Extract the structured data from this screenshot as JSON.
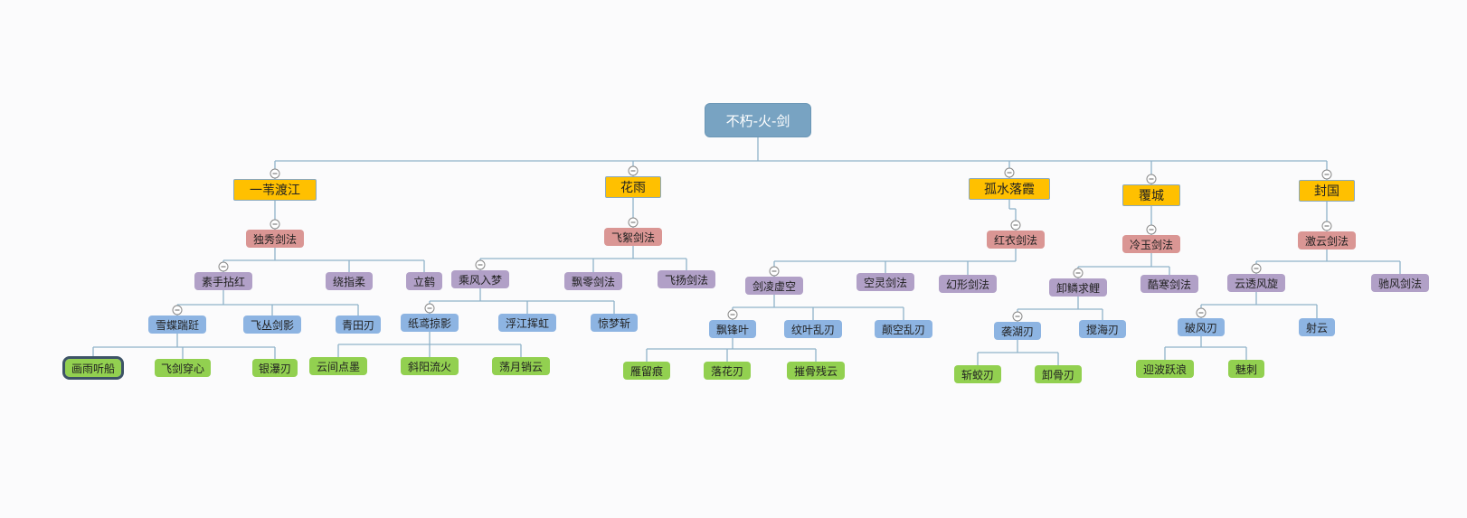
{
  "theme": {
    "root_color": "#78a3c2",
    "level1_color": "#ffc000",
    "level2_color": "#da9694",
    "level3_color": "#b1a0c7",
    "level4_color": "#8db4e2",
    "level5_color": "#92d050",
    "line_color": "#8fb2c9"
  },
  "selected_node": "画雨听船",
  "mindmap": {
    "label": "不朽-火-剑",
    "children": [
      {
        "label": "一苇渡江",
        "collapsible": true,
        "children": [
          {
            "label": "独秀剑法",
            "collapsible": true,
            "children": [
              {
                "label": "素手拈红",
                "collapsible": true,
                "children": [
                  {
                    "label": "雪蝶踹跹",
                    "collapsible": true,
                    "children": [
                      {
                        "label": "画雨听船"
                      },
                      {
                        "label": "飞剑穿心"
                      },
                      {
                        "label": "银瀑刃"
                      }
                    ]
                  },
                  {
                    "label": "飞丛剑影"
                  },
                  {
                    "label": "青田刃"
                  }
                ]
              },
              {
                "label": "绕指柔"
              },
              {
                "label": "立鹤"
              }
            ]
          }
        ]
      },
      {
        "label": "花雨",
        "collapsible": true,
        "children": [
          {
            "label": "飞絮剑法",
            "collapsible": true,
            "children": [
              {
                "label": "乘风入梦",
                "collapsible": true,
                "children": [
                  {
                    "label": "纸鸢掠影",
                    "collapsible": true,
                    "children": [
                      {
                        "label": "云间点墨"
                      },
                      {
                        "label": "斜阳流火"
                      },
                      {
                        "label": "荡月销云"
                      }
                    ]
                  },
                  {
                    "label": "浮江挥虹"
                  },
                  {
                    "label": "惊梦斩"
                  }
                ]
              },
              {
                "label": "飘零剑法"
              },
              {
                "label": "飞扬剑法"
              }
            ]
          }
        ]
      },
      {
        "label": "孤水落霞",
        "collapsible": true,
        "children": [
          {
            "label": "红衣剑法",
            "collapsible": true,
            "children": [
              {
                "label": "剑凌虚空",
                "collapsible": true,
                "children": [
                  {
                    "label": "飘锋叶",
                    "collapsible": true,
                    "children": [
                      {
                        "label": "雁留痕"
                      },
                      {
                        "label": "落花刃"
                      },
                      {
                        "label": "摧骨残云"
                      }
                    ]
                  },
                  {
                    "label": "纹叶乱刃"
                  },
                  {
                    "label": "颠空乱刃"
                  }
                ]
              },
              {
                "label": "空灵剑法"
              },
              {
                "label": "幻形剑法"
              }
            ]
          }
        ]
      },
      {
        "label": "覆城",
        "collapsible": true,
        "children": [
          {
            "label": "冷玉剑法",
            "collapsible": true,
            "children": [
              {
                "label": "卸鳞求鲤",
                "collapsible": true,
                "children": [
                  {
                    "label": "袭湖刃",
                    "collapsible": true,
                    "children": [
                      {
                        "label": "斩蛟刃"
                      },
                      {
                        "label": "卸骨刃"
                      }
                    ]
                  },
                  {
                    "label": "搅海刃"
                  }
                ]
              },
              {
                "label": "酷寒剑法"
              }
            ]
          }
        ]
      },
      {
        "label": "封国",
        "collapsible": true,
        "children": [
          {
            "label": "激云剑法",
            "collapsible": true,
            "children": [
              {
                "label": "云透风旋",
                "collapsible": true,
                "children": [
                  {
                    "label": "破风刃",
                    "collapsible": true,
                    "children": [
                      {
                        "label": "迎波跃浪"
                      },
                      {
                        "label": "魅刺"
                      }
                    ]
                  },
                  {
                    "label": "射云"
                  }
                ]
              },
              {
                "label": "驰风剑法"
              }
            ]
          }
        ]
      }
    ]
  }
}
